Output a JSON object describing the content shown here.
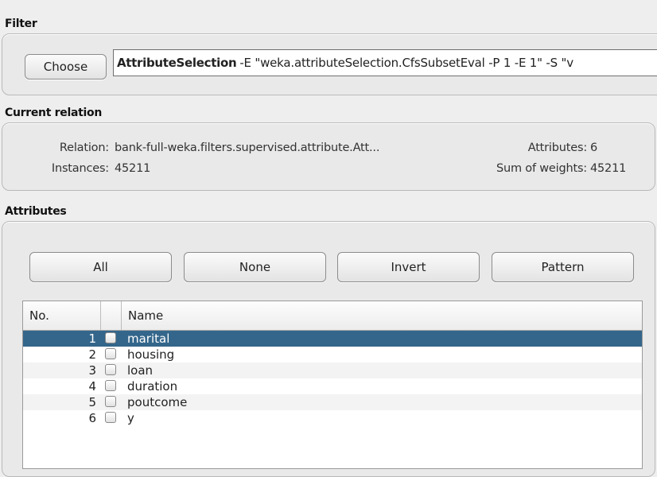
{
  "filter": {
    "section_title": "Filter",
    "choose_label": "Choose",
    "name": "AttributeSelection",
    "options": "-E \"weka.attributeSelection.CfsSubsetEval -P 1 -E 1\" -S \"v"
  },
  "current_relation": {
    "section_title": "Current relation",
    "relation_label": "Relation:",
    "relation_value": "bank-full-weka.filters.supervised.attribute.Att...",
    "instances_label": "Instances:",
    "instances_value": "45211",
    "attributes_label": "Attributes:",
    "attributes_value": "6",
    "sum_weights_label": "Sum of weights:",
    "sum_weights_value": "45211"
  },
  "attributes": {
    "section_title": "Attributes",
    "buttons": {
      "all": "All",
      "none": "None",
      "invert": "Invert",
      "pattern": "Pattern"
    },
    "columns": {
      "no": "No.",
      "name": "Name"
    },
    "rows": [
      {
        "no": "1",
        "name": "marital"
      },
      {
        "no": "2",
        "name": "housing"
      },
      {
        "no": "3",
        "name": "loan"
      },
      {
        "no": "4",
        "name": "duration"
      },
      {
        "no": "5",
        "name": "poutcome"
      },
      {
        "no": "6",
        "name": "y"
      }
    ],
    "selected_row": 1
  },
  "colors": {
    "selection": "#34668b",
    "background": "#eeeeee"
  }
}
